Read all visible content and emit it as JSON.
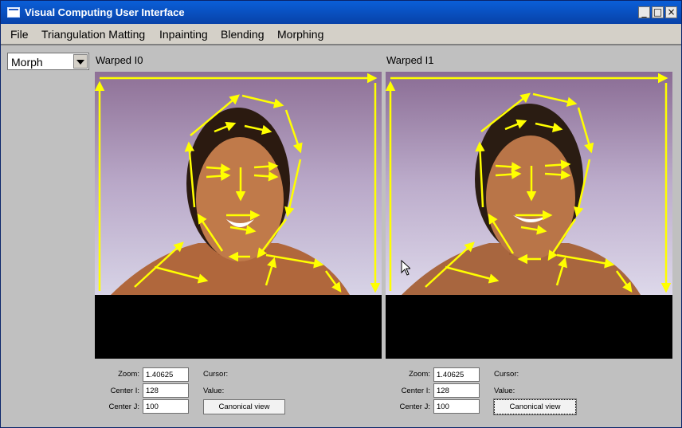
{
  "window": {
    "title": "Visual Computing User Interface"
  },
  "menu": [
    "File",
    "Triangulation Matting",
    "Inpainting",
    "Blending",
    "Morphing"
  ],
  "mode_select": {
    "value": "Morph"
  },
  "panels": [
    {
      "title": "Warped I0",
      "zoom_label": "Zoom:",
      "zoom_value": "1.40625",
      "centeri_label": "Center I:",
      "centeri_value": "128",
      "centerj_label": "Center J:",
      "centerj_value": "100",
      "cursor_label": "Cursor:",
      "value_label": "Value:",
      "canonical_label": "Canonical view"
    },
    {
      "title": "Warped I1",
      "zoom_label": "Zoom:",
      "zoom_value": "1.40625",
      "centeri_label": "Center I:",
      "centeri_value": "128",
      "centerj_label": "Center J:",
      "centerj_value": "100",
      "cursor_label": "Cursor:",
      "value_label": "Value:",
      "canonical_label": "Canonical view"
    }
  ],
  "colors": {
    "feature_lines": "#ffff00",
    "titlebar": "#0842a8"
  }
}
